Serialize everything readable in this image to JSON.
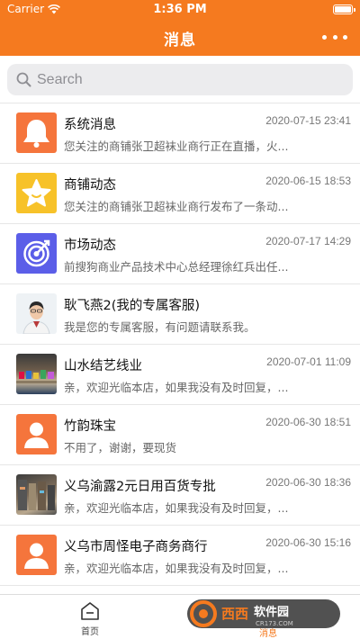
{
  "status_bar": {
    "carrier": "Carrier",
    "time": "1:36 PM"
  },
  "nav": {
    "title": "消息",
    "more_icon": "more-icon"
  },
  "search": {
    "placeholder": "Search"
  },
  "messages": [
    {
      "title": "系统消息",
      "time": "2020-07-15 23:41",
      "preview": "您关注的商铺张卫超袜业商行正在直播，火...",
      "avatar": "bell-icon"
    },
    {
      "title": "商铺动态",
      "time": "2020-06-15 18:53",
      "preview": "您关注的商铺张卫超袜业商行发布了一条动...",
      "avatar": "star-icon"
    },
    {
      "title": "市场动态",
      "time": "2020-07-17 14:29",
      "preview": "前搜狗商业产品技术中心总经理徐红兵出任...",
      "avatar": "target-icon"
    },
    {
      "title": "耿飞燕2(我的专属客服)",
      "time": "",
      "preview": "我是您的专属客服，有问题请联系我。",
      "avatar": "person-photo"
    },
    {
      "title": "山水结艺线业",
      "time": "2020-07-01 11:09",
      "preview": "亲，欢迎光临本店，如果我没有及时回复，...",
      "avatar": "shop-photo"
    },
    {
      "title": "竹韵珠宝",
      "time": "2020-06-30 18:51",
      "preview": "不用了，谢谢，要现货",
      "avatar": "user-icon"
    },
    {
      "title": "义乌渝露2元日用百货专批",
      "time": "2020-06-30 18:36",
      "preview": "亲，欢迎光临本店，如果我没有及时回复，...",
      "avatar": "store-photo"
    },
    {
      "title": "义乌市周怪电子商务商行",
      "time": "2020-06-30 15:16",
      "preview": "亲，欢迎光临本店，如果我没有及时回复，...",
      "avatar": "user-icon"
    }
  ],
  "tabbar": {
    "home_label": "首页",
    "messages_label": "消息"
  },
  "watermark": {
    "text": "西西软件园",
    "url_text": "CR173.COM"
  },
  "colors": {
    "accent": "#f57a1f",
    "bell_bg": "#f5753c",
    "star_bg": "#f7c229",
    "target_bg": "#5b5ee8"
  }
}
